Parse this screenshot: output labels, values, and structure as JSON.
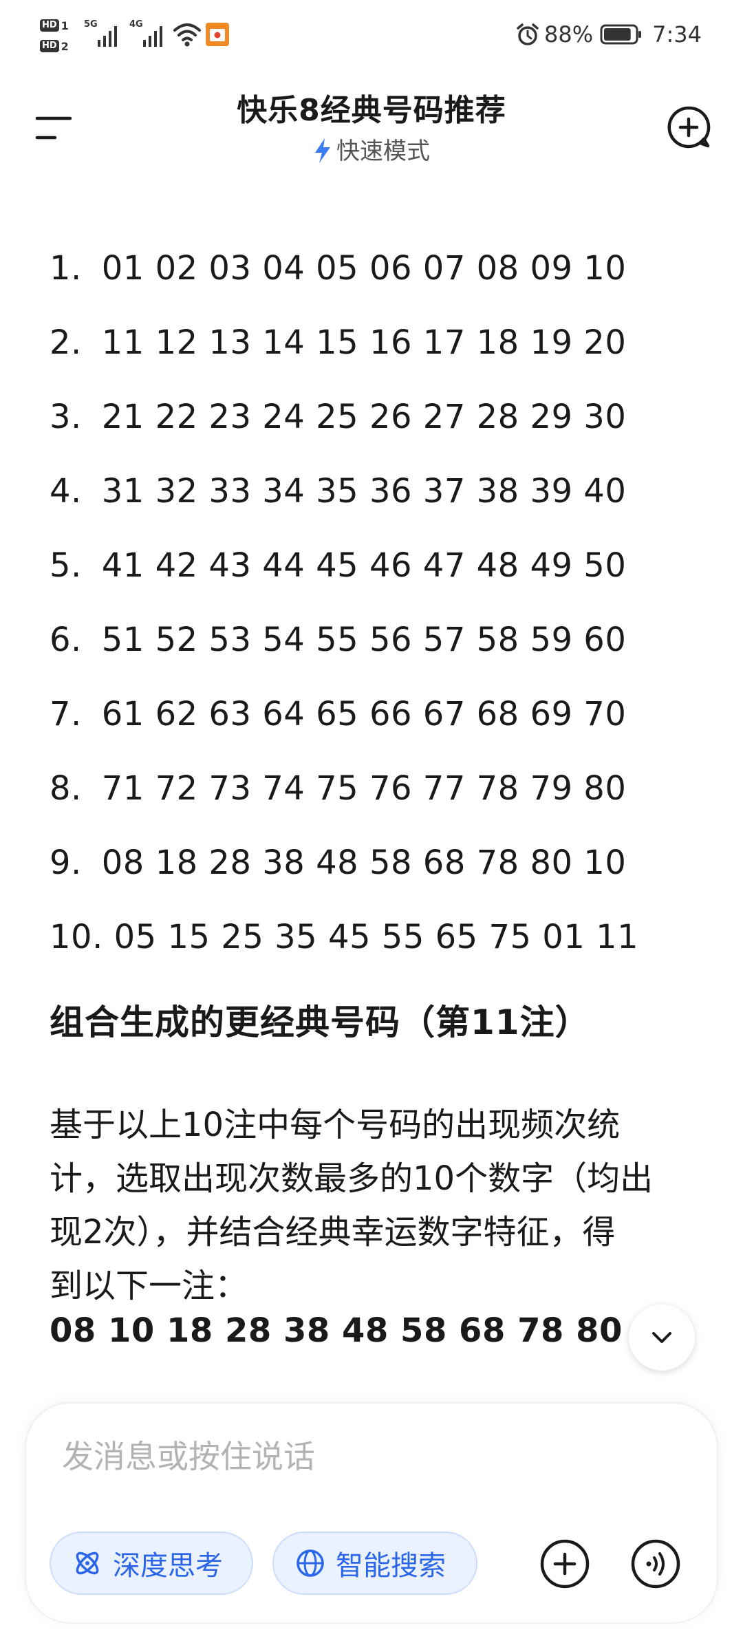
{
  "status_bar": {
    "hd1": "HD",
    "hd1_num": "1",
    "hd2": "HD",
    "hd2_num": "2",
    "net1": "5G",
    "net2": "4G",
    "battery_percent": "88%",
    "battery_level": 0.88,
    "time": "7:34",
    "icons": [
      "signal-icon",
      "wifi-icon",
      "app-notification-icon",
      "alarm-icon",
      "battery-icon"
    ]
  },
  "header": {
    "title": "快乐8经典号码推荐",
    "mode": "快速模式",
    "icons": [
      "menu-icon",
      "lightning-icon",
      "new-chat-icon"
    ]
  },
  "content": {
    "number_list": [
      {
        "index": "1.",
        "numbers": "01 02 03 04 05 06 07 08 09 10"
      },
      {
        "index": "2.",
        "numbers": "11 12 13 14 15 16 17 18 19 20"
      },
      {
        "index": "3.",
        "numbers": "21 22 23 24 25 26 27 28 29 30"
      },
      {
        "index": "4.",
        "numbers": "31 32 33 34 35 36 37 38 39 40"
      },
      {
        "index": "5.",
        "numbers": "41 42 43 44 45 46 47 48 49 50"
      },
      {
        "index": "6.",
        "numbers": "51 52 53 54 55 56 57 58 59 60"
      },
      {
        "index": "7.",
        "numbers": "61 62 63 64 65 66 67 68 69 70"
      },
      {
        "index": "8.",
        "numbers": "71 72 73 74 75 76 77 78 79 80"
      },
      {
        "index": "9.",
        "numbers": "08 18 28 38 48 58 68 78 80 10"
      },
      {
        "index": "10.",
        "numbers": "05 15 25 35 45 55 65 75 01 11"
      }
    ],
    "section_title": "组合生成的更经典号码（第11注）",
    "paragraph_lines": [
      "基于以上10注中每个号码的出现频次统",
      "计，选取出现次数最多的10个数字（均出",
      "现2次），并结合经典幸运数字特征，得",
      "到以下一注："
    ],
    "result": "08 10 18 28 38 48 58 68 78 80"
  },
  "composer": {
    "placeholder": "发消息或按住说话",
    "deep_think_label": "深度思考",
    "smart_search_label": "智能搜索",
    "icons": [
      "atom-icon",
      "globe-icon",
      "plus-icon",
      "voice-icon",
      "chevron-down-icon"
    ]
  },
  "colors": {
    "accent": "#2c66e8",
    "chip_bg": "#eaf1ff",
    "bolt": "#3b7cf5",
    "text": "#1a1a1a"
  }
}
